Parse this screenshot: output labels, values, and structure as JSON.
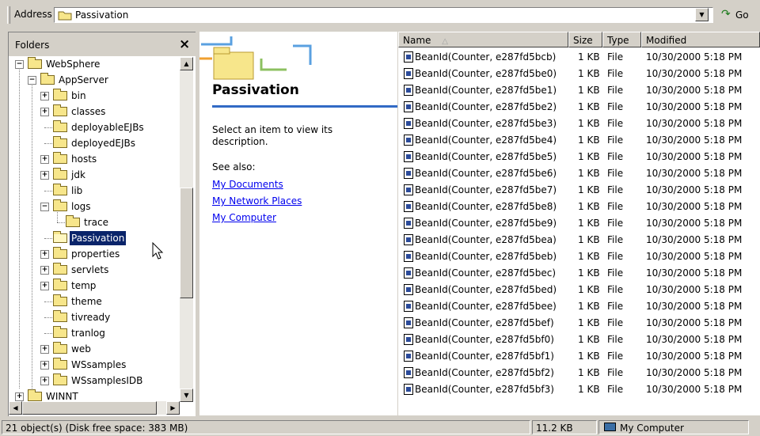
{
  "address": {
    "label": "Address",
    "value": "Passivation",
    "go_label": "Go"
  },
  "folders_pane": {
    "title": "Folders",
    "close": "×",
    "tree": [
      {
        "label": "WebSphere",
        "indent": 0,
        "expander": "−"
      },
      {
        "label": "AppServer",
        "indent": 1,
        "expander": "−"
      },
      {
        "label": "bin",
        "indent": 2,
        "expander": "+"
      },
      {
        "label": "classes",
        "indent": 2,
        "expander": "+"
      },
      {
        "label": "deployableEJBs",
        "indent": 2,
        "expander": ""
      },
      {
        "label": "deployedEJBs",
        "indent": 2,
        "expander": ""
      },
      {
        "label": "hosts",
        "indent": 2,
        "expander": "+"
      },
      {
        "label": "jdk",
        "indent": 2,
        "expander": "+"
      },
      {
        "label": "lib",
        "indent": 2,
        "expander": ""
      },
      {
        "label": "logs",
        "indent": 2,
        "expander": "−"
      },
      {
        "label": "trace",
        "indent": 3,
        "expander": ""
      },
      {
        "label": "Passivation",
        "indent": 2,
        "expander": "",
        "selected": true
      },
      {
        "label": "properties",
        "indent": 2,
        "expander": "+"
      },
      {
        "label": "servlets",
        "indent": 2,
        "expander": "+"
      },
      {
        "label": "temp",
        "indent": 2,
        "expander": "+"
      },
      {
        "label": "theme",
        "indent": 2,
        "expander": ""
      },
      {
        "label": "tivready",
        "indent": 2,
        "expander": ""
      },
      {
        "label": "tranlog",
        "indent": 2,
        "expander": ""
      },
      {
        "label": "web",
        "indent": 2,
        "expander": "+"
      },
      {
        "label": "WSsamples",
        "indent": 2,
        "expander": "+"
      },
      {
        "label": "WSsamplesIDB",
        "indent": 2,
        "expander": "+"
      },
      {
        "label": "WINNT",
        "indent": 0,
        "expander": "+"
      }
    ]
  },
  "info_pane": {
    "title": "Passivation",
    "description": "Select an item to view its description.",
    "see_also": "See also:",
    "links": [
      "My Documents",
      "My Network Places",
      "My Computer"
    ]
  },
  "file_list": {
    "columns": {
      "name": "Name",
      "sort_indicator": "△",
      "size": "Size",
      "type": "Type",
      "modified": "Modified"
    },
    "rows": [
      {
        "name": "BeanId(Counter, e287fd5bcb)",
        "size": "1 KB",
        "type": "File",
        "modified": "10/30/2000 5:18 PM"
      },
      {
        "name": "BeanId(Counter, e287fd5be0)",
        "size": "1 KB",
        "type": "File",
        "modified": "10/30/2000 5:18 PM"
      },
      {
        "name": "BeanId(Counter, e287fd5be1)",
        "size": "1 KB",
        "type": "File",
        "modified": "10/30/2000 5:18 PM"
      },
      {
        "name": "BeanId(Counter, e287fd5be2)",
        "size": "1 KB",
        "type": "File",
        "modified": "10/30/2000 5:18 PM"
      },
      {
        "name": "BeanId(Counter, e287fd5be3)",
        "size": "1 KB",
        "type": "File",
        "modified": "10/30/2000 5:18 PM"
      },
      {
        "name": "BeanId(Counter, e287fd5be4)",
        "size": "1 KB",
        "type": "File",
        "modified": "10/30/2000 5:18 PM"
      },
      {
        "name": "BeanId(Counter, e287fd5be5)",
        "size": "1 KB",
        "type": "File",
        "modified": "10/30/2000 5:18 PM"
      },
      {
        "name": "BeanId(Counter, e287fd5be6)",
        "size": "1 KB",
        "type": "File",
        "modified": "10/30/2000 5:18 PM"
      },
      {
        "name": "BeanId(Counter, e287fd5be7)",
        "size": "1 KB",
        "type": "File",
        "modified": "10/30/2000 5:18 PM"
      },
      {
        "name": "BeanId(Counter, e287fd5be8)",
        "size": "1 KB",
        "type": "File",
        "modified": "10/30/2000 5:18 PM"
      },
      {
        "name": "BeanId(Counter, e287fd5be9)",
        "size": "1 KB",
        "type": "File",
        "modified": "10/30/2000 5:18 PM"
      },
      {
        "name": "BeanId(Counter, e287fd5bea)",
        "size": "1 KB",
        "type": "File",
        "modified": "10/30/2000 5:18 PM"
      },
      {
        "name": "BeanId(Counter, e287fd5beb)",
        "size": "1 KB",
        "type": "File",
        "modified": "10/30/2000 5:18 PM"
      },
      {
        "name": "BeanId(Counter, e287fd5bec)",
        "size": "1 KB",
        "type": "File",
        "modified": "10/30/2000 5:18 PM"
      },
      {
        "name": "BeanId(Counter, e287fd5bed)",
        "size": "1 KB",
        "type": "File",
        "modified": "10/30/2000 5:18 PM"
      },
      {
        "name": "BeanId(Counter, e287fd5bee)",
        "size": "1 KB",
        "type": "File",
        "modified": "10/30/2000 5:18 PM"
      },
      {
        "name": "BeanId(Counter, e287fd5bef)",
        "size": "1 KB",
        "type": "File",
        "modified": "10/30/2000 5:18 PM"
      },
      {
        "name": "BeanId(Counter, e287fd5bf0)",
        "size": "1 KB",
        "type": "File",
        "modified": "10/30/2000 5:18 PM"
      },
      {
        "name": "BeanId(Counter, e287fd5bf1)",
        "size": "1 KB",
        "type": "File",
        "modified": "10/30/2000 5:18 PM"
      },
      {
        "name": "BeanId(Counter, e287fd5bf2)",
        "size": "1 KB",
        "type": "File",
        "modified": "10/30/2000 5:18 PM"
      },
      {
        "name": "BeanId(Counter, e287fd5bf3)",
        "size": "1 KB",
        "type": "File",
        "modified": "10/30/2000 5:18 PM"
      }
    ]
  },
  "status_bar": {
    "objects": "21 object(s) (Disk free space: 383 MB)",
    "size": "11.2 KB",
    "zone": "My Computer"
  }
}
